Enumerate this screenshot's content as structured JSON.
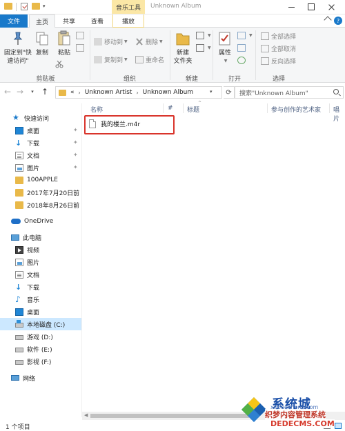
{
  "titlebar": {
    "context_tab": "音乐工具",
    "window_title": "Unknown Album",
    "dropdown": "▾"
  },
  "tabs": {
    "file": "文件",
    "home": "主页",
    "share": "共享",
    "view": "查看",
    "play": "播放",
    "help": "?"
  },
  "ribbon": {
    "clipboard": {
      "pin_line1": "固定到\"快",
      "pin_line2": "速访问\"",
      "copy": "复制",
      "paste": "粘贴",
      "label": "剪贴板"
    },
    "organize": {
      "move_to": "移动到",
      "copy_to": "复制到",
      "delete": "删除",
      "rename": "重命名",
      "label": "组织"
    },
    "new": {
      "new_folder_line1": "新建",
      "new_folder_line2": "文件夹",
      "label": "新建"
    },
    "open": {
      "properties": "属性",
      "label": "打开"
    },
    "select": {
      "select_all": "全部选择",
      "select_none": "全部取消",
      "invert": "反向选择",
      "label": "选择"
    }
  },
  "address": {
    "overflow": "«",
    "crumbs": [
      "Unknown Artist",
      "Unknown Album"
    ],
    "search_placeholder": "搜索\"Unknown Album\""
  },
  "navpane": {
    "items": [
      {
        "label": "快速访问",
        "icon": "star-icon"
      },
      {
        "label": "桌面",
        "icon": "desktop-icon",
        "pinned": true
      },
      {
        "label": "下载",
        "icon": "download-icon",
        "pinned": true
      },
      {
        "label": "文档",
        "icon": "document-icon",
        "pinned": true
      },
      {
        "label": "图片",
        "icon": "picture-icon",
        "pinned": true
      },
      {
        "label": "100APPLE",
        "icon": "folder-icon"
      },
      {
        "label": "2017年7月20日前",
        "icon": "folder-icon"
      },
      {
        "label": "2018年8月26日前",
        "icon": "folder-icon"
      },
      {
        "label": "OneDrive",
        "icon": "cloud-icon"
      },
      {
        "label": "此电脑",
        "icon": "pc-icon"
      },
      {
        "label": "视频",
        "icon": "video-icon"
      },
      {
        "label": "图片",
        "icon": "picture-icon"
      },
      {
        "label": "文档",
        "icon": "document-icon"
      },
      {
        "label": "下载",
        "icon": "download-icon"
      },
      {
        "label": "音乐",
        "icon": "music-icon"
      },
      {
        "label": "桌面",
        "icon": "desktop-icon"
      },
      {
        "label": "本地磁盘 (C:)",
        "icon": "drive-c-icon",
        "selected": true
      },
      {
        "label": "游戏 (D:)",
        "icon": "drive-icon"
      },
      {
        "label": "软件 (E:)",
        "icon": "drive-icon"
      },
      {
        "label": "影视 (F:)",
        "icon": "drive-icon"
      },
      {
        "label": "网络",
        "icon": "network-icon"
      }
    ]
  },
  "content": {
    "columns": [
      "名称",
      "#",
      "标题",
      "参与创作的艺术家",
      "唱片"
    ],
    "files": [
      {
        "name": "我的楼兰.m4r"
      }
    ]
  },
  "status": {
    "count": "1 个项目"
  },
  "watermark": {
    "brand": "系统城",
    "domain_small": "xitongcheng.com",
    "cn": "织梦内容管理系统",
    "url": "DEDECMS.COM"
  },
  "colors": {
    "accent": "#1979ca",
    "highlight_border": "#d9342b",
    "context_tab": "#fbe7a6",
    "selection": "#cce8ff"
  }
}
